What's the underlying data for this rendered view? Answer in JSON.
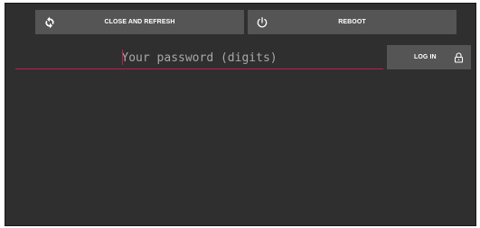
{
  "toolbar": {
    "close_refresh_label": "CLOSE AND REFRESH",
    "close_refresh_icon": "refresh-icon",
    "reboot_label": "REBOOT",
    "reboot_icon": "power-icon"
  },
  "login": {
    "password_placeholder": "Your password (digits)",
    "password_value": "",
    "login_label": "LOG IN",
    "login_icon": "lock-icon"
  },
  "colors": {
    "background": "#2f2f2f",
    "button": "#555555",
    "button_text": "#ffffff",
    "accent": "#c2185b",
    "placeholder": "#a8a8a8"
  }
}
